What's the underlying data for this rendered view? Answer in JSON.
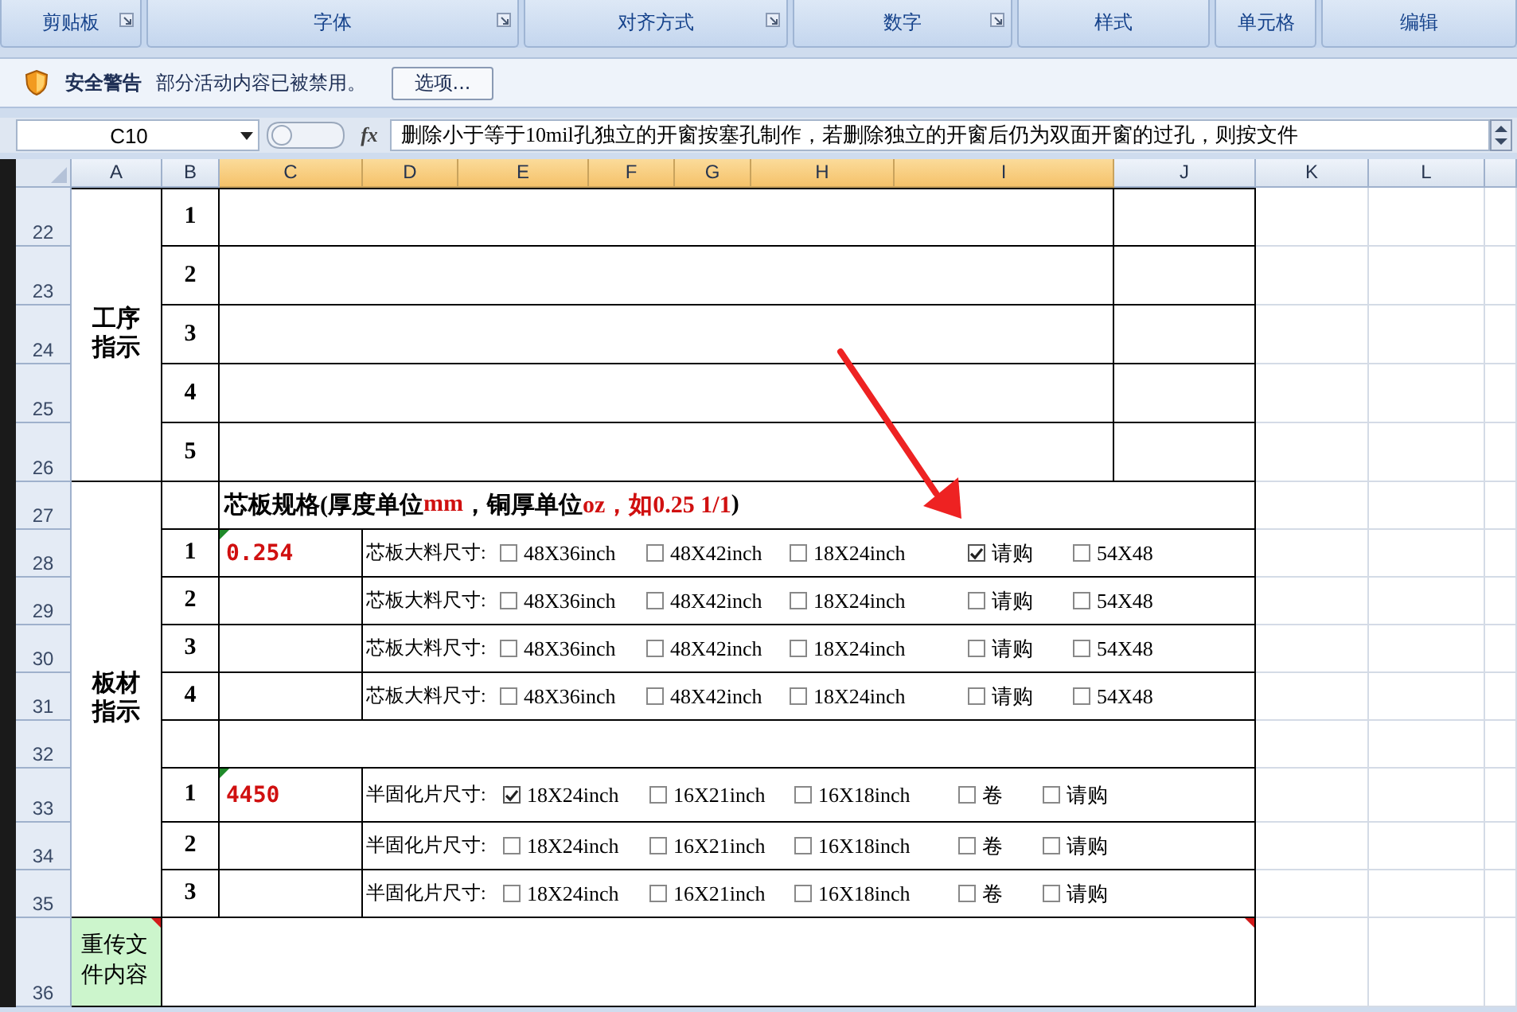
{
  "ribbon_groups": [
    {
      "label": "剪贴板",
      "launcher": true
    },
    {
      "label": "字体",
      "launcher": true
    },
    {
      "label": "对齐方式",
      "launcher": true
    },
    {
      "label": "数字",
      "launcher": true
    },
    {
      "label": "样式",
      "launcher": false
    },
    {
      "label": "单元格",
      "launcher": false
    },
    {
      "label": "编辑",
      "launcher": false
    }
  ],
  "security_bar": {
    "title": "安全警告",
    "message": "部分活动内容已被禁用。",
    "button": "选项..."
  },
  "formula_bar": {
    "name_box": "C10",
    "fx": "fx",
    "content": "删除小于等于10mil孔独立的开窗按塞孔制作，若删除独立的开窗后仍为双面开窗的过孔，则按文件"
  },
  "column_headers": [
    {
      "label": "A",
      "selected": false
    },
    {
      "label": "B",
      "selected": false
    },
    {
      "label": "C",
      "selected": true
    },
    {
      "label": "D",
      "selected": true
    },
    {
      "label": "E",
      "selected": true
    },
    {
      "label": "F",
      "selected": true
    },
    {
      "label": "G",
      "selected": true
    },
    {
      "label": "H",
      "selected": true
    },
    {
      "label": "I",
      "selected": true
    },
    {
      "label": "J",
      "selected": false
    },
    {
      "label": "K",
      "selected": false
    },
    {
      "label": "L",
      "selected": false
    }
  ],
  "row_headers": [
    "22",
    "23",
    "24",
    "25",
    "26",
    "27",
    "28",
    "29",
    "30",
    "31",
    "32",
    "33",
    "34",
    "35",
    "36"
  ],
  "process_section": {
    "label": "工序指示",
    "rows": [
      "1",
      "2",
      "3",
      "4",
      "5"
    ]
  },
  "material_section": {
    "label": "板材指示",
    "title_parts": [
      {
        "text": "芯板规格(厚度单位",
        "kind": "plain"
      },
      {
        "text": "mm",
        "kind": "accent"
      },
      {
        "text": "，铜厚单位",
        "kind": "plain"
      },
      {
        "text": "oz，如0.25 1/1",
        "kind": "accent"
      },
      {
        "text": ")",
        "kind": "plain"
      }
    ],
    "core_rows": [
      {
        "number": "1",
        "value": "0.254",
        "flagged": true,
        "label": "芯板大料尺寸:",
        "options": [
          {
            "text": "48X36inch",
            "checked": false
          },
          {
            "text": "48X42inch",
            "checked": false
          },
          {
            "text": "18X24inch",
            "checked": false
          },
          {
            "text": "请购",
            "checked": true
          },
          {
            "text": "54X48",
            "checked": false
          }
        ]
      },
      {
        "number": "2",
        "flagged": false,
        "label": "芯板大料尺寸:",
        "options": [
          {
            "text": "48X36inch",
            "checked": false
          },
          {
            "text": "48X42inch",
            "checked": false
          },
          {
            "text": "18X24inch",
            "checked": false
          },
          {
            "text": "请购",
            "checked": false
          },
          {
            "text": "54X48",
            "checked": false
          }
        ]
      },
      {
        "number": "3",
        "flagged": false,
        "label": "芯板大料尺寸:",
        "options": [
          {
            "text": "48X36inch",
            "checked": false
          },
          {
            "text": "48X42inch",
            "checked": false
          },
          {
            "text": "18X24inch",
            "checked": false
          },
          {
            "text": "请购",
            "checked": false
          },
          {
            "text": "54X48",
            "checked": false
          }
        ]
      },
      {
        "number": "4",
        "flagged": false,
        "label": "芯板大料尺寸:",
        "options": [
          {
            "text": "48X36inch",
            "checked": false
          },
          {
            "text": "48X42inch",
            "checked": false
          },
          {
            "text": "18X24inch",
            "checked": false
          },
          {
            "text": "请购",
            "checked": false
          },
          {
            "text": "54X48",
            "checked": false
          }
        ]
      }
    ],
    "prepreg_rows": [
      {
        "number": "1",
        "value": "4450",
        "flagged": true,
        "label": "半固化片尺寸:",
        "options": [
          {
            "text": "18X24inch",
            "checked": true
          },
          {
            "text": "16X21inch",
            "checked": false
          },
          {
            "text": "16X18inch",
            "checked": false
          },
          {
            "text": "卷",
            "checked": false
          },
          {
            "text": "请购",
            "checked": false
          }
        ]
      },
      {
        "number": "2",
        "flagged": false,
        "label": "半固化片尺寸:",
        "options": [
          {
            "text": "18X24inch",
            "checked": false
          },
          {
            "text": "16X21inch",
            "checked": false
          },
          {
            "text": "16X18inch",
            "checked": false
          },
          {
            "text": "卷",
            "checked": false
          },
          {
            "text": "请购",
            "checked": false
          }
        ]
      },
      {
        "number": "3",
        "flagged": false,
        "label": "半固化片尺寸:",
        "options": [
          {
            "text": "18X24inch",
            "checked": false
          },
          {
            "text": "16X21inch",
            "checked": false
          },
          {
            "text": "16X18inch",
            "checked": false
          },
          {
            "text": "卷",
            "checked": false
          },
          {
            "text": "请购",
            "checked": false
          }
        ]
      }
    ]
  },
  "reupload": {
    "label": "重传文件内容",
    "label_note": true,
    "content_note": true
  }
}
